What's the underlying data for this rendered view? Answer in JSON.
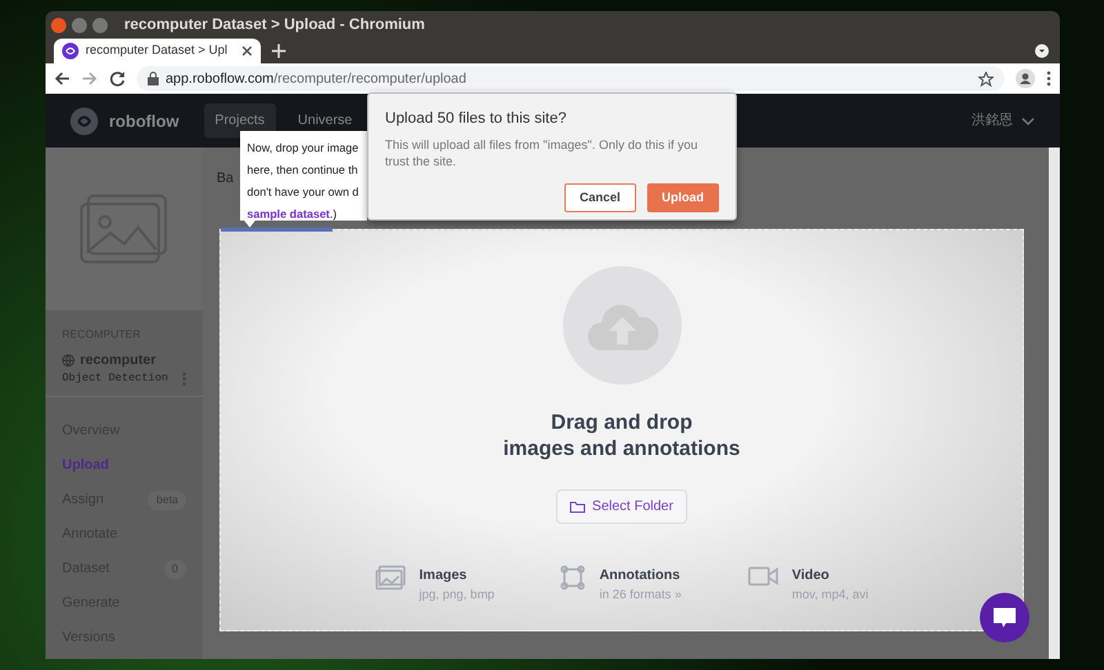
{
  "window": {
    "title": "recomputer Dataset > Upload - Chromium"
  },
  "tabs": [
    {
      "label": "recomputer Dataset > Upl",
      "selected": true
    }
  ],
  "address_bar": {
    "host": "app.roboflow.com",
    "path": "/recomputer/recomputer/upload"
  },
  "navbar": {
    "brand": "roboflow",
    "links": [
      {
        "label": "Projects",
        "selected": true
      },
      {
        "label": "Universe",
        "selected": false
      }
    ],
    "user": "洪銘恩"
  },
  "sidebar": {
    "workspace": "RECOMPUTER",
    "project": "recomputer",
    "project_type": "Object Detection",
    "items": [
      {
        "label": "Overview",
        "selected": false
      },
      {
        "label": "Upload",
        "selected": true
      },
      {
        "label": "Assign",
        "selected": false,
        "badge": "beta"
      },
      {
        "label": "Annotate",
        "selected": false
      },
      {
        "label": "Dataset",
        "selected": false,
        "badge": "0"
      },
      {
        "label": "Generate",
        "selected": false
      },
      {
        "label": "Versions",
        "selected": false
      }
    ]
  },
  "main": {
    "heading": "Ba"
  },
  "tooltip": {
    "lines": [
      "Now, drop your image",
      "here, then continue th",
      "don't have your own d"
    ],
    "link": "sample dataset",
    "link_suffix": ".)"
  },
  "dialog": {
    "title": "Upload 50 files to this site?",
    "message": "This will upload all files from \"images\". Only do this if you trust the site.",
    "buttons": [
      {
        "label": "Cancel",
        "kind": "secondary"
      },
      {
        "label": "Upload",
        "kind": "primary"
      }
    ]
  },
  "dropzone": {
    "progress": {
      "level": 0.14
    },
    "heading_lines": [
      "Drag and drop",
      "images and annotations"
    ],
    "button": "Select Folder",
    "formats": [
      {
        "kind": "images",
        "title": "Images",
        "detail": "jpg, png, bmp"
      },
      {
        "kind": "annotations",
        "title": "Annotations",
        "detail": "in 26 formats »"
      },
      {
        "kind": "video",
        "title": "Video",
        "detail": "mov, mp4, avi"
      }
    ]
  }
}
